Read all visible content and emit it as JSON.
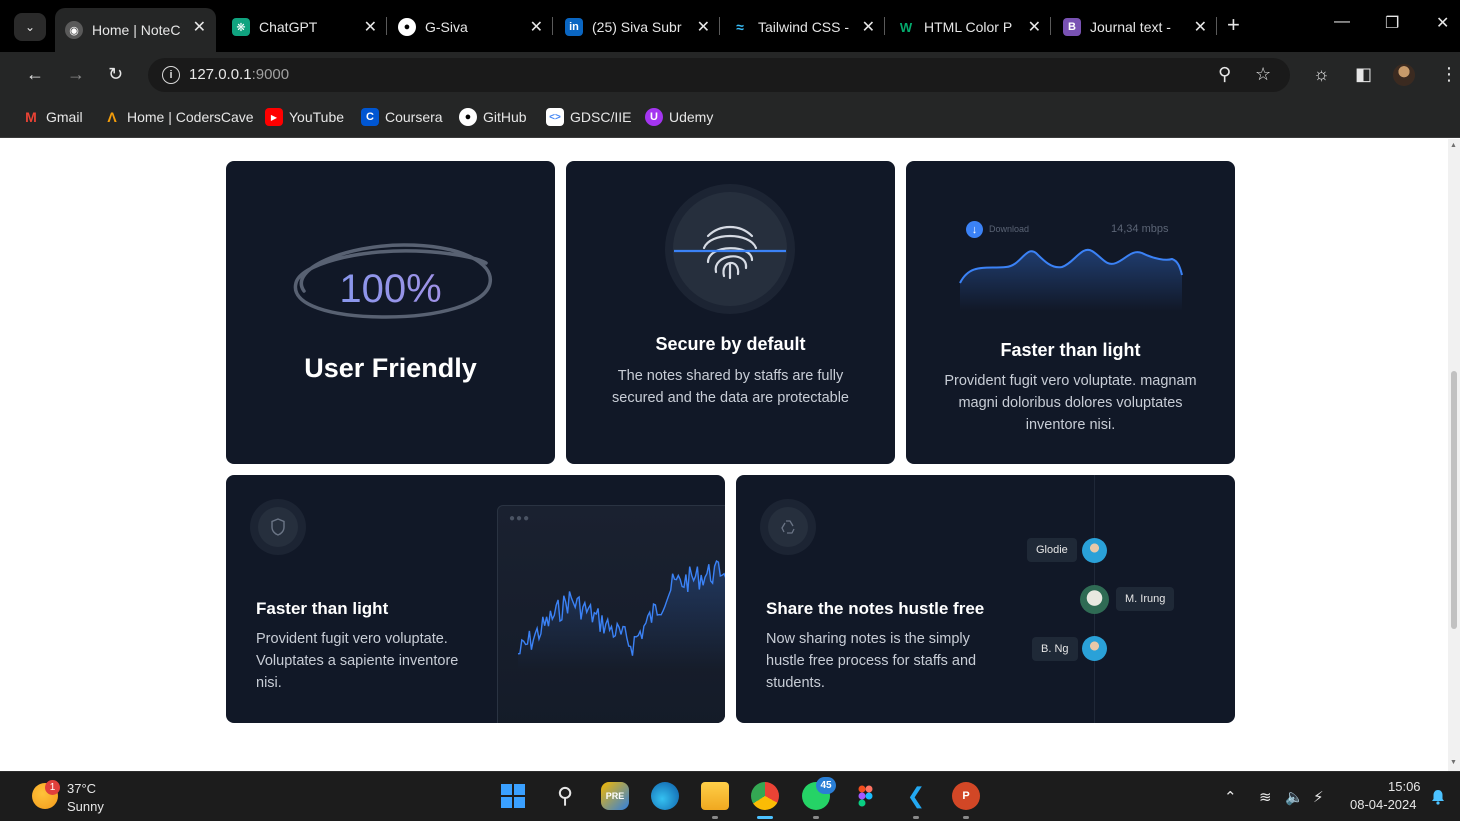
{
  "browser": {
    "tabs": [
      {
        "title": "Home | NoteC",
        "active": true,
        "favicon": "globe-icon"
      },
      {
        "title": "ChatGPT",
        "active": false,
        "favicon": "chatgpt-icon"
      },
      {
        "title": "G-Siva",
        "active": false,
        "favicon": "github-icon"
      },
      {
        "title": "(25) Siva Subr",
        "active": false,
        "favicon": "linkedin-icon"
      },
      {
        "title": "Tailwind CSS -",
        "active": false,
        "favicon": "tailwind-icon"
      },
      {
        "title": "HTML Color P",
        "active": false,
        "favicon": "w3schools-icon"
      },
      {
        "title": "Journal text - ",
        "active": false,
        "favicon": "bootstrap-icon"
      }
    ],
    "address": {
      "host": "127.0.0.1",
      "port": ":9000"
    },
    "bookmarks": [
      {
        "label": "Gmail",
        "icon": "gmail-icon",
        "color": "#ea4335"
      },
      {
        "label": "Home | CodersCave",
        "icon": "coderscave-icon",
        "color": "#f59e0b"
      },
      {
        "label": "YouTube",
        "icon": "youtube-icon",
        "color": "#ff0000"
      },
      {
        "label": "Coursera",
        "icon": "coursera-icon",
        "color": "#0056d2"
      },
      {
        "label": "GitHub",
        "icon": "github-icon",
        "color": "#ffffff"
      },
      {
        "label": "GDSC/IIE",
        "icon": "gdsc-icon",
        "color": "#4285f4"
      },
      {
        "label": "Udemy",
        "icon": "udemy-icon",
        "color": "#a435f0"
      }
    ]
  },
  "cards": {
    "user_friendly": {
      "percent": "100%",
      "title": "User Friendly"
    },
    "secure": {
      "title": "Secure by default",
      "text": "The notes shared by staffs are fully secured and the data are protectable"
    },
    "faster": {
      "download_label": "Download",
      "download_value": "14,34 mbps",
      "title": "Faster than light",
      "text": "Provident fugit vero voluptate. magnam magni doloribus dolores voluptates inventore nisi."
    },
    "faster2": {
      "title": "Faster than light",
      "text": "Provident fugit vero voluptate. Voluptates a sapiente inventore nisi."
    },
    "share": {
      "title": "Share the notes hustle free",
      "text": "Now sharing notes is the simply hustle free process for staffs and students.",
      "users": [
        "Glodie",
        "M. Irung",
        "B. Ng"
      ]
    }
  },
  "colors": {
    "card_bg": "#111827",
    "accent_blue": "#3b82f6",
    "page_bg": "#ffffff"
  },
  "taskbar": {
    "weather": {
      "temp": "37°C",
      "desc": "Sunny",
      "badge": "1"
    },
    "whatsapp_badge": "45",
    "time": "15:06",
    "date": "08-04-2024"
  }
}
